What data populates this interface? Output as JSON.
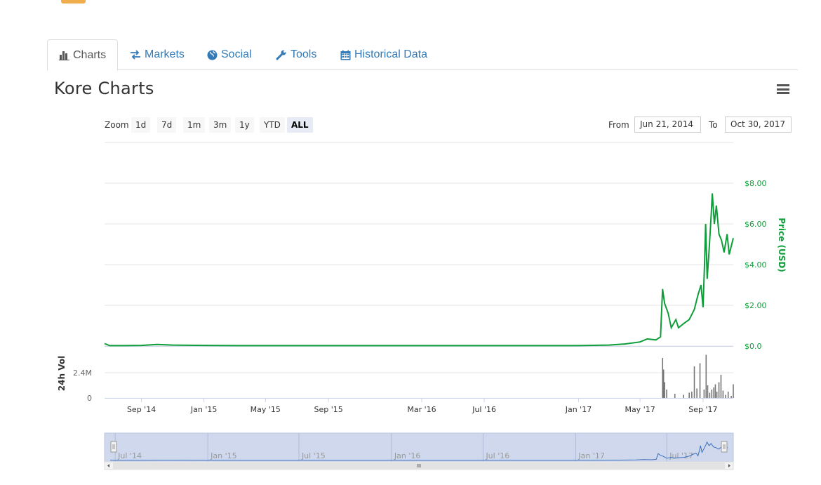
{
  "tabs": [
    {
      "label": "Charts",
      "icon": "bar-chart-icon",
      "active": true
    },
    {
      "label": "Markets",
      "icon": "exchange-icon",
      "active": false
    },
    {
      "label": "Social",
      "icon": "globe-icon",
      "active": false
    },
    {
      "label": "Tools",
      "icon": "wrench-icon",
      "active": false
    },
    {
      "label": "Historical Data",
      "icon": "calendar-icon",
      "active": false
    }
  ],
  "page_title": "Kore Charts",
  "zoom": {
    "label": "Zoom",
    "buttons": [
      "1d",
      "7d",
      "1m",
      "3m",
      "1y",
      "YTD",
      "ALL"
    ],
    "selected": "ALL"
  },
  "range": {
    "from_label": "From",
    "from_value": "Jun 21, 2014",
    "to_label": "To",
    "to_value": "Oct 30, 2017"
  },
  "colors": {
    "price_line": "#0f9d3a",
    "volume_bar": "#777777",
    "navigator_fill": "#cfd8ec",
    "navigator_line": "#3b6fbf",
    "accent_link": "#337ab7"
  },
  "chart_data": {
    "type": "line",
    "x_type": "date",
    "xlim": [
      "2014-06-21",
      "2017-10-30"
    ],
    "x_ticks": [
      {
        "date": "2014-09-01",
        "label": "Sep '14"
      },
      {
        "date": "2015-01-01",
        "label": "Jan '15"
      },
      {
        "date": "2015-05-01",
        "label": "May '15"
      },
      {
        "date": "2015-09-01",
        "label": "Sep '15"
      },
      {
        "date": "2016-03-01",
        "label": "Mar '16"
      },
      {
        "date": "2016-07-01",
        "label": "Jul '16"
      },
      {
        "date": "2017-01-01",
        "label": "Jan '17"
      },
      {
        "date": "2017-05-01",
        "label": "May '17"
      },
      {
        "date": "2017-09-01",
        "label": "Sep '17"
      }
    ],
    "price_axis": {
      "label": "Price (USD)",
      "ylim": [
        0,
        10
      ],
      "ticks": [
        {
          "v": 0,
          "label": "$0.0"
        },
        {
          "v": 2,
          "label": "$2.00"
        },
        {
          "v": 4,
          "label": "$4.00"
        },
        {
          "v": 6,
          "label": "$6.00"
        },
        {
          "v": 8,
          "label": "$8.00"
        }
      ],
      "grid": true
    },
    "volume_axis": {
      "label": "24h Vol",
      "ylim": [
        0,
        4800000
      ],
      "ticks": [
        {
          "v": 0,
          "label": "0"
        },
        {
          "v": 2400000,
          "label": "2.4M"
        }
      ]
    },
    "price": [
      [
        "2014-06-21",
        0.12
      ],
      [
        "2014-07-01",
        0.02
      ],
      [
        "2014-08-01",
        0.02
      ],
      [
        "2014-09-01",
        0.03
      ],
      [
        "2014-10-01",
        0.08
      ],
      [
        "2014-11-01",
        0.05
      ],
      [
        "2015-01-01",
        0.03
      ],
      [
        "2015-03-01",
        0.02
      ],
      [
        "2015-06-01",
        0.02
      ],
      [
        "2015-09-01",
        0.02
      ],
      [
        "2016-01-01",
        0.02
      ],
      [
        "2016-05-01",
        0.02
      ],
      [
        "2016-09-01",
        0.02
      ],
      [
        "2017-01-01",
        0.02
      ],
      [
        "2017-03-01",
        0.05
      ],
      [
        "2017-04-01",
        0.1
      ],
      [
        "2017-05-01",
        0.2
      ],
      [
        "2017-05-15",
        0.35
      ],
      [
        "2017-06-01",
        0.3
      ],
      [
        "2017-06-10",
        0.45
      ],
      [
        "2017-06-14",
        2.8
      ],
      [
        "2017-06-18",
        2.1
      ],
      [
        "2017-06-25",
        1.6
      ],
      [
        "2017-07-01",
        0.9
      ],
      [
        "2017-07-10",
        1.3
      ],
      [
        "2017-07-15",
        0.9
      ],
      [
        "2017-07-25",
        1.1
      ],
      [
        "2017-08-05",
        1.3
      ],
      [
        "2017-08-15",
        1.8
      ],
      [
        "2017-08-22",
        2.5
      ],
      [
        "2017-08-28",
        3.0
      ],
      [
        "2017-09-01",
        1.9
      ],
      [
        "2017-09-04",
        4.1
      ],
      [
        "2017-09-06",
        6.0
      ],
      [
        "2017-09-09",
        3.3
      ],
      [
        "2017-09-13",
        4.8
      ],
      [
        "2017-09-17",
        6.5
      ],
      [
        "2017-09-19",
        7.5
      ],
      [
        "2017-09-23",
        6.0
      ],
      [
        "2017-09-27",
        6.9
      ],
      [
        "2017-10-02",
        5.5
      ],
      [
        "2017-10-07",
        5.2
      ],
      [
        "2017-10-12",
        4.6
      ],
      [
        "2017-10-18",
        5.5
      ],
      [
        "2017-10-22",
        4.5
      ],
      [
        "2017-10-26",
        4.9
      ],
      [
        "2017-10-30",
        5.3
      ]
    ],
    "volume": [
      [
        "2017-06-14",
        3800000
      ],
      [
        "2017-06-16",
        2700000
      ],
      [
        "2017-06-18",
        1500000
      ],
      [
        "2017-06-22",
        800000
      ],
      [
        "2017-07-08",
        400000
      ],
      [
        "2017-07-25",
        300000
      ],
      [
        "2017-08-05",
        500000
      ],
      [
        "2017-08-10",
        600000
      ],
      [
        "2017-08-15",
        3000000
      ],
      [
        "2017-08-20",
        900000
      ],
      [
        "2017-08-26",
        3300000
      ],
      [
        "2017-09-03",
        800000
      ],
      [
        "2017-09-07",
        4100000
      ],
      [
        "2017-09-10",
        1200000
      ],
      [
        "2017-09-14",
        500000
      ],
      [
        "2017-09-18",
        800000
      ],
      [
        "2017-09-22",
        1000000
      ],
      [
        "2017-09-25",
        1300000
      ],
      [
        "2017-09-28",
        600000
      ],
      [
        "2017-10-02",
        1500000
      ],
      [
        "2017-10-06",
        2200000
      ],
      [
        "2017-10-10",
        700000
      ],
      [
        "2017-10-15",
        300000
      ],
      [
        "2017-10-20",
        600000
      ],
      [
        "2017-10-26",
        200000
      ],
      [
        "2017-10-30",
        1300000
      ]
    ],
    "navigator": {
      "x_ticks": [
        {
          "date": "2014-07-01",
          "label": "Jul '14"
        },
        {
          "date": "2015-01-01",
          "label": "Jan '15"
        },
        {
          "date": "2015-07-01",
          "label": "Jul '15"
        },
        {
          "date": "2016-01-01",
          "label": "Jan '16"
        },
        {
          "date": "2016-07-01",
          "label": "Jul '16"
        },
        {
          "date": "2017-01-01",
          "label": "Jan '17"
        },
        {
          "date": "2017-07-01",
          "label": "Jul '17"
        }
      ]
    }
  }
}
